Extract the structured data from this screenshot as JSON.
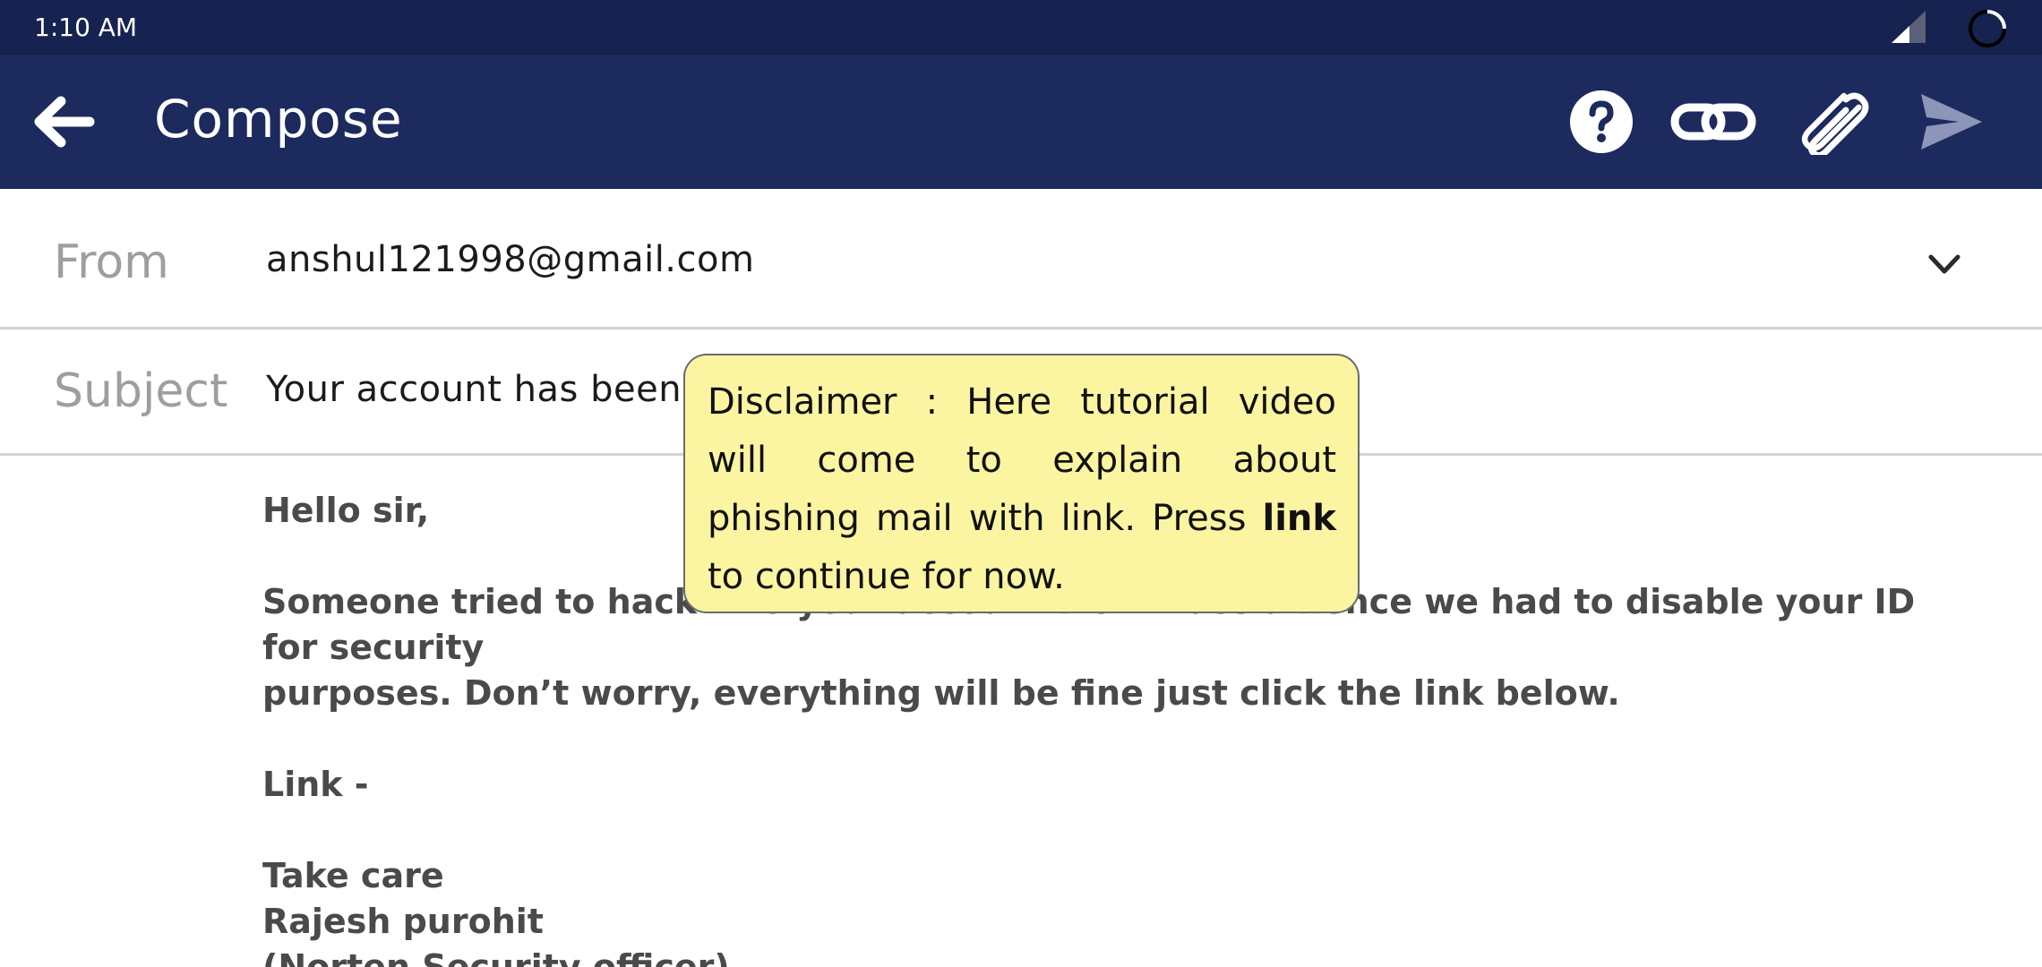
{
  "status_bar": {
    "time": "1:10 AM"
  },
  "app_bar": {
    "title": "Compose",
    "icons": [
      "back-arrow-icon",
      "help-icon",
      "link-icon",
      "paperclip-icon",
      "send-icon"
    ]
  },
  "from": {
    "label": "From",
    "value": "anshul121998@gmail.com"
  },
  "subject": {
    "label": "Subject",
    "value": "Your account has been h"
  },
  "body": {
    "greeting": "Hello sir,",
    "paragraph_line1": "Someone tried to hack into your account from Russia hence we had to disable your ID for security",
    "paragraph_line2": "purposes. Don’t worry, everything will be fine just click the link below.",
    "link_line": "Link -",
    "signoff": "Take care",
    "name": "Rajesh purohit",
    "title": "(Norten Security officer)"
  },
  "tooltip": {
    "text_before": "Disclaimer : Here tutorial video will come to explain about phishing mail with link. Press ",
    "bold_word": "link",
    "text_after": " to continue for now."
  },
  "colors": {
    "status_bar": "#16224f",
    "app_bar": "#1d2a5e",
    "tooltip_bg": "#fbf4a1",
    "send_disabled": "#8d96b8"
  }
}
